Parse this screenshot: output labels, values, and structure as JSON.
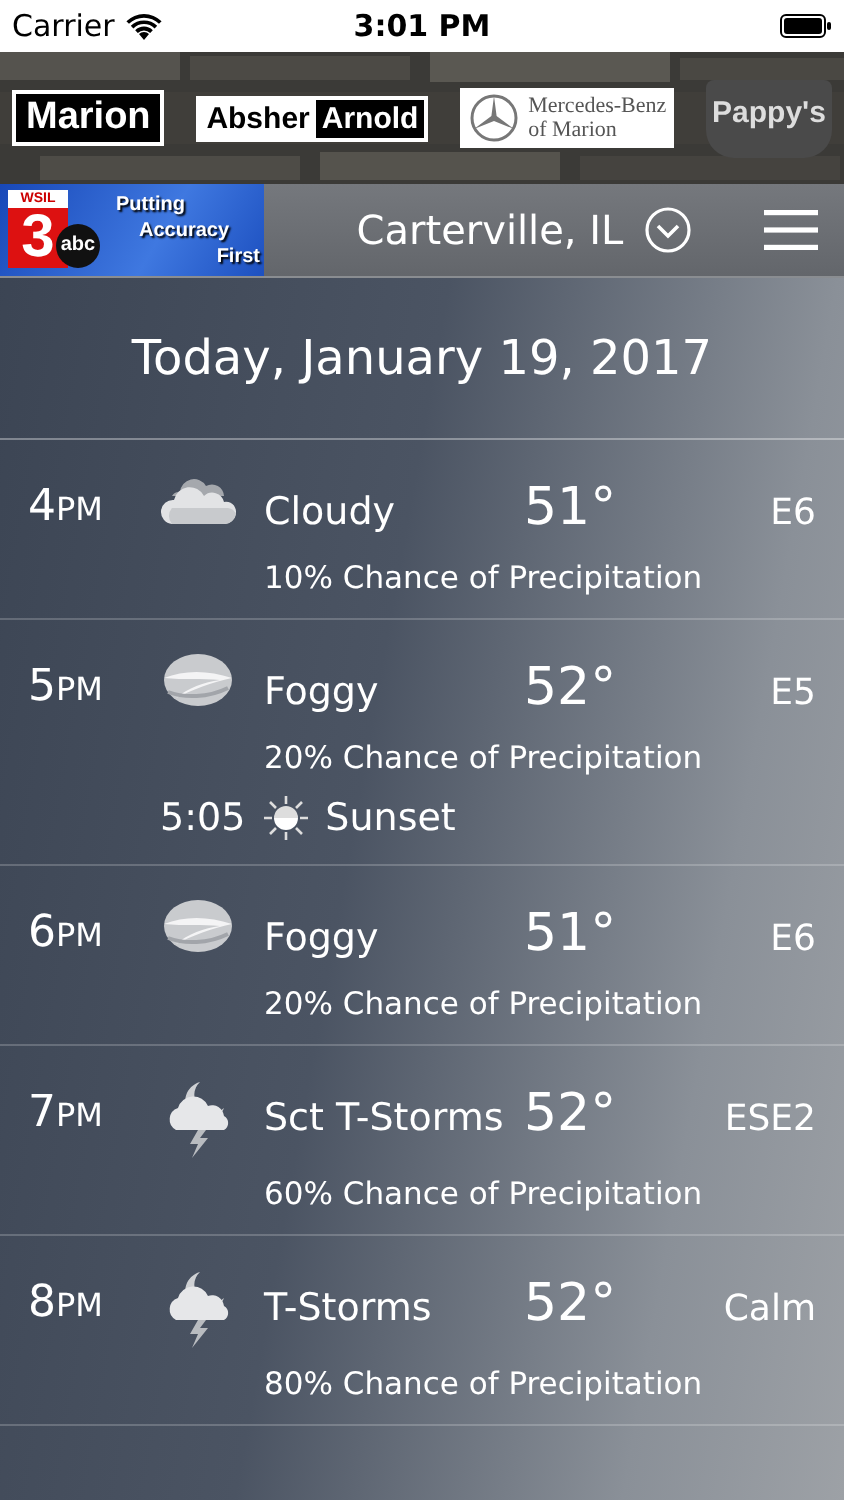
{
  "status_bar": {
    "carrier": "Carrier",
    "time": "3:01 PM"
  },
  "sponsor_banner": {
    "logos": [
      {
        "kind": "boxed",
        "text": "Marion"
      },
      {
        "kind": "split",
        "text": "Absher",
        "text_2": "Arnold"
      },
      {
        "kind": "star",
        "text": "Mercedes-Benz",
        "text_2": "of Marion"
      },
      {
        "kind": "shield",
        "text": "Pappy's"
      }
    ]
  },
  "header": {
    "station_logo": {
      "callsign": "WSIL",
      "channel": "3",
      "network": "abc",
      "slogan": [
        "Putting",
        "Accuracy",
        "First"
      ]
    },
    "location": "Carterville, IL"
  },
  "date": "Today, January 19, 2017",
  "hours": [
    {
      "hour": "4",
      "meridiem": "PM",
      "kind": "cloudy",
      "condition": "Cloudy",
      "temp": "51°",
      "wind": "E6",
      "precip": "10% Chance of Precipitation"
    },
    {
      "hour": "5",
      "meridiem": "PM",
      "kind": "fog",
      "condition": "Foggy",
      "temp": "52°",
      "wind": "E5",
      "precip": "20% Chance of Precipitation",
      "event": {
        "time": "5:05",
        "label": "Sunset"
      }
    },
    {
      "hour": "6",
      "meridiem": "PM",
      "kind": "fog",
      "condition": "Foggy",
      "temp": "51°",
      "wind": "E6",
      "precip": "20% Chance of Precipitation"
    },
    {
      "hour": "7",
      "meridiem": "PM",
      "kind": "storm-night",
      "condition": "Sct T-Storms",
      "temp": "52°",
      "wind": "ESE2",
      "precip": "60% Chance of Precipitation"
    },
    {
      "hour": "8",
      "meridiem": "PM",
      "kind": "storm-night",
      "condition": "T-Storms",
      "temp": "52°",
      "wind": "Calm",
      "precip": "80% Chance of Precipitation"
    }
  ]
}
